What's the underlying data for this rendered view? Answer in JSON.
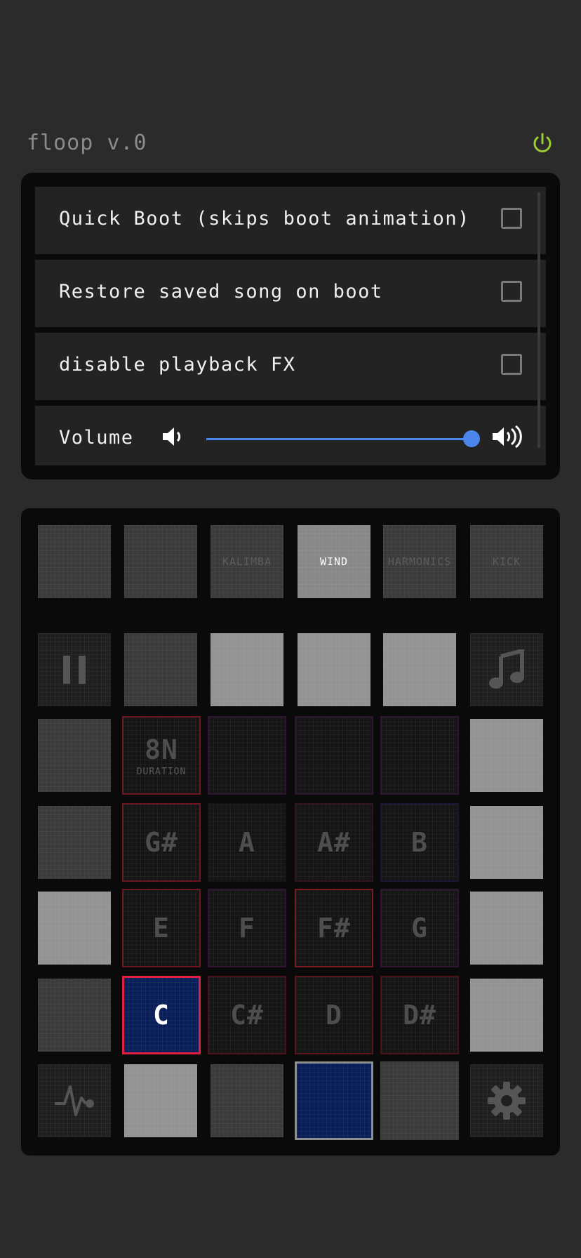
{
  "app": {
    "title": "floop v.0"
  },
  "settings": {
    "quick_boot": {
      "label": "Quick Boot (skips boot animation)"
    },
    "restore_song": {
      "label": "Restore saved song on boot"
    },
    "disable_fx": {
      "label": "disable playback FX"
    },
    "volume": {
      "label": "Volume",
      "level": 1.0
    }
  },
  "instruments": [
    "",
    "",
    "KALIMBA",
    "WIND",
    "HARMONICS",
    "KICK"
  ],
  "duration": {
    "value": "8N",
    "label": "DURATION"
  },
  "notes": {
    "row1": [
      "G#",
      "A",
      "A#",
      "B"
    ],
    "row2": [
      "E",
      "F",
      "F#",
      "G"
    ],
    "row3": [
      "C",
      "C#",
      "D",
      "D#"
    ]
  },
  "colors": {
    "accent_blue": "#4a86ec",
    "power_green": "#9acd32",
    "active_note_border": "#e0203d",
    "active_note_fill": "#0a1f5a"
  },
  "icons": {
    "power": "power-icon",
    "volume_low": "volume-low-icon",
    "volume_high": "volume-high-icon",
    "pause": "pause-icon",
    "music": "music-note-icon",
    "waveform": "waveform-icon",
    "settings": "gear-icon"
  }
}
